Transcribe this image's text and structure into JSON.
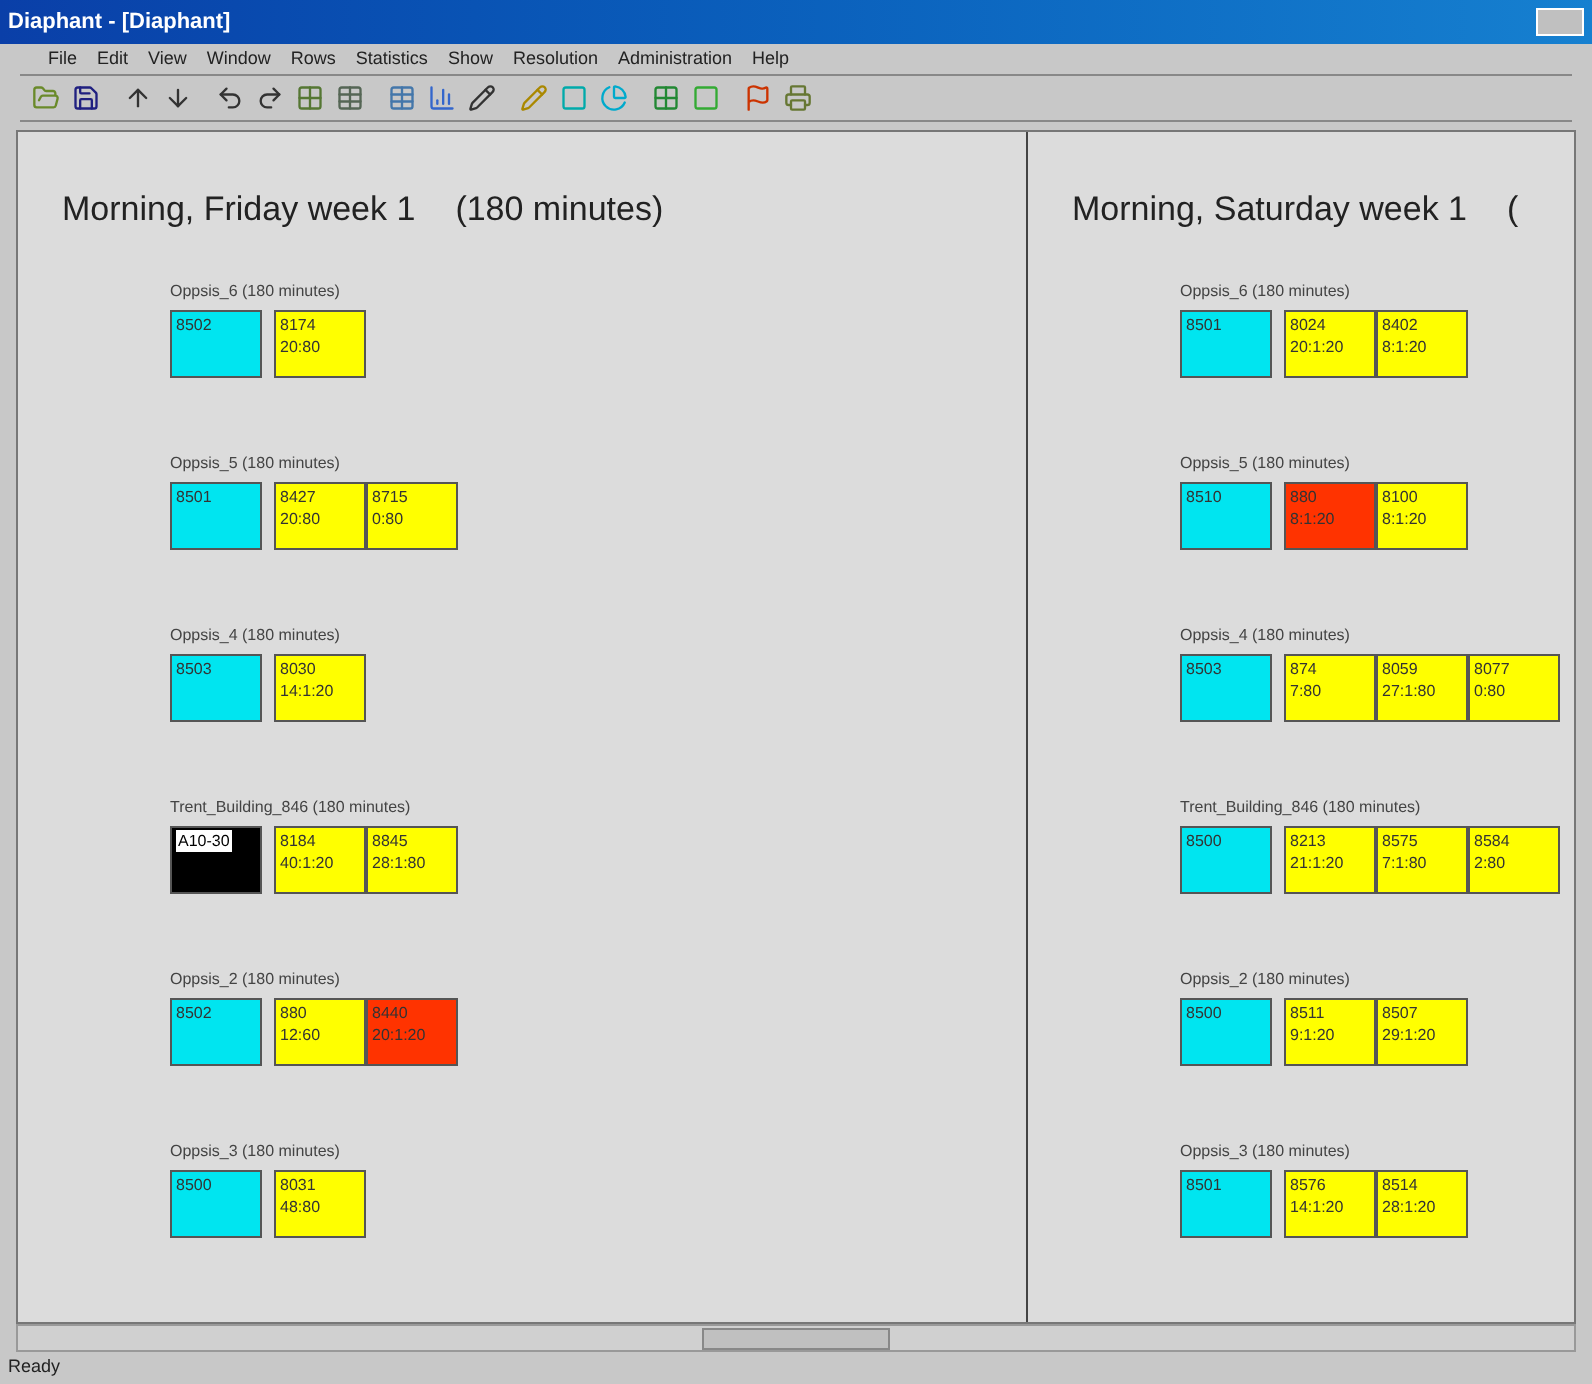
{
  "window": {
    "title": "Diaphant - [Diaphant]"
  },
  "menu": [
    "File",
    "Edit",
    "View",
    "Window",
    "Rows",
    "Statistics",
    "Show",
    "Resolution",
    "Administration",
    "Help"
  ],
  "days": [
    {
      "title": "Morning, Friday week 1",
      "duration": "(180 minutes)",
      "rooms": [
        {
          "name": "Oppsis_6 (180 minutes)",
          "cells": [
            {
              "color": "#00e5f0",
              "lines": [
                "8502"
              ]
            },
            {
              "color": "#ffff00",
              "lines": [
                "8174",
                "20:80"
              ]
            }
          ]
        },
        {
          "name": "Oppsis_5 (180 minutes)",
          "cells": [
            {
              "color": "#00e5f0",
              "lines": [
                "8501"
              ]
            },
            {
              "color": "#ffff00",
              "lines": [
                "8427",
                "20:80"
              ]
            },
            {
              "color": "#ffff00",
              "lines": [
                "8715",
                "0:80"
              ]
            }
          ]
        },
        {
          "name": "Oppsis_4 (180 minutes)",
          "cells": [
            {
              "color": "#00e5f0",
              "lines": [
                "8503"
              ]
            },
            {
              "color": "#ffff00",
              "lines": [
                "8030",
                "14:1:20"
              ]
            }
          ]
        },
        {
          "name": "Trent_Building_846 (180 minutes)",
          "cells": [
            {
              "color": "#000000",
              "lines": [
                "A10-30"
              ]
            },
            {
              "color": "#ffff00",
              "lines": [
                "8184",
                "40:1:20"
              ]
            },
            {
              "color": "#ffff00",
              "lines": [
                "8845",
                "28:1:80"
              ]
            }
          ]
        },
        {
          "name": "Oppsis_2 (180 minutes)",
          "cells": [
            {
              "color": "#00e5f0",
              "lines": [
                "8502"
              ]
            },
            {
              "color": "#ffff00",
              "lines": [
                "880",
                "12:60"
              ]
            },
            {
              "color": "#ff3300",
              "lines": [
                "8440",
                "20:1:20"
              ]
            }
          ]
        },
        {
          "name": "Oppsis_3 (180 minutes)",
          "cells": [
            {
              "color": "#00e5f0",
              "lines": [
                "8500"
              ]
            },
            {
              "color": "#ffff00",
              "lines": [
                "8031",
                "48:80"
              ]
            }
          ]
        }
      ]
    },
    {
      "title": "Morning, Saturday week 1",
      "duration": "(",
      "rooms": [
        {
          "name": "Oppsis_6 (180 minutes)",
          "cells": [
            {
              "color": "#00e5f0",
              "lines": [
                "8501"
              ]
            },
            {
              "color": "#ffff00",
              "lines": [
                "8024",
                "20:1:20"
              ]
            },
            {
              "color": "#ffff00",
              "lines": [
                "8402",
                "8:1:20"
              ]
            }
          ]
        },
        {
          "name": "Oppsis_5 (180 minutes)",
          "cells": [
            {
              "color": "#00e5f0",
              "lines": [
                "8510"
              ]
            },
            {
              "color": "#ff3300",
              "lines": [
                "880",
                "8:1:20"
              ]
            },
            {
              "color": "#ffff00",
              "lines": [
                "8100",
                "8:1:20"
              ]
            }
          ]
        },
        {
          "name": "Oppsis_4 (180 minutes)",
          "cells": [
            {
              "color": "#00e5f0",
              "lines": [
                "8503"
              ]
            },
            {
              "color": "#ffff00",
              "lines": [
                "874",
                "7:80"
              ]
            },
            {
              "color": "#ffff00",
              "lines": [
                "8059",
                "27:1:80"
              ]
            },
            {
              "color": "#ffff00",
              "lines": [
                "8077",
                "0:80"
              ]
            }
          ]
        },
        {
          "name": "Trent_Building_846 (180 minutes)",
          "cells": [
            {
              "color": "#00e5f0",
              "lines": [
                "8500"
              ]
            },
            {
              "color": "#ffff00",
              "lines": [
                "8213",
                "21:1:20"
              ]
            },
            {
              "color": "#ffff00",
              "lines": [
                "8575",
                "7:1:80"
              ]
            },
            {
              "color": "#ffff00",
              "lines": [
                "8584",
                "2:80"
              ]
            }
          ]
        },
        {
          "name": "Oppsis_2 (180 minutes)",
          "cells": [
            {
              "color": "#00e5f0",
              "lines": [
                "8500"
              ]
            },
            {
              "color": "#ffff00",
              "lines": [
                "8511",
                "9:1:20"
              ]
            },
            {
              "color": "#ffff00",
              "lines": [
                "8507",
                "29:1:20"
              ]
            }
          ]
        },
        {
          "name": "Oppsis_3 (180 minutes)",
          "cells": [
            {
              "color": "#00e5f0",
              "lines": [
                "8501"
              ]
            },
            {
              "color": "#ffff00",
              "lines": [
                "8576",
                "14:1:20"
              ]
            },
            {
              "color": "#ffff00",
              "lines": [
                "8514",
                "28:1:20"
              ]
            }
          ]
        }
      ]
    }
  ],
  "status_bar": {
    "text": "Ready"
  }
}
